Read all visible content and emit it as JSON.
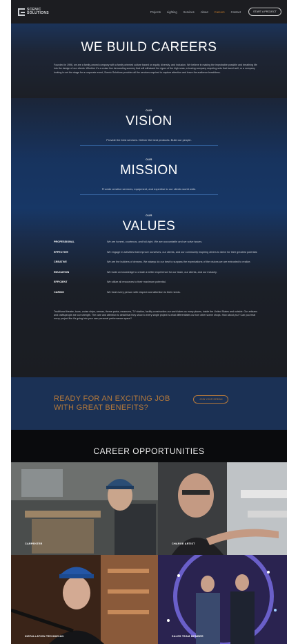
{
  "nav": {
    "logo_line1": "SCENIC",
    "logo_line2": "SOLUTIONS",
    "items": [
      "Projects",
      "Lighting",
      "Services",
      "About",
      "Careers",
      "Contact"
    ],
    "cta": "START A PROJECT"
  },
  "hero": {
    "title": "WE BUILD CAREERS",
    "text": "Founded in 1996, we are a family-owned company with a family oriented culture based on equity, diversity, and inclusion. We believe in making the improbable possible and breathing life into the design of our clients. Whether it's a cruise line demanding scenery that will withstand the rigors of the high seas, a touring company requiring sets that travel well, or a company looking to set the stage for a corporate event, Scenic Solutions provides all the services required to capture attention and leave the audience breathless."
  },
  "vision": {
    "kicker": "OUR",
    "title": "VISION",
    "statement": "Provide the best services. Deliver the best products. Build our people."
  },
  "mission": {
    "kicker": "OUR",
    "title": "MISSION",
    "statement": "Provide creative services, equipment, and expertise to our clients world wide."
  },
  "values": {
    "kicker": "OUR",
    "title": "VALUES",
    "rows": [
      {
        "label": "PROFESSIONAL",
        "desc": "We are honest, courteous, and full-right. We are accountable and we solve issues."
      },
      {
        "label": "EFFECTIVE",
        "desc": "We engage in activities that improve ourselves, our clients, and our community inspiring others to strive for their greatest potential."
      },
      {
        "label": "CREATIVE",
        "desc": "We are the builders of dreams. We always do our best to surpass the expectations of the visions we are entrusted to realize."
      },
      {
        "label": "EDUCATION",
        "desc": "We build on knowledge to create a better experience for our team, our clients, and our industry."
      },
      {
        "label": "EFFICIENT",
        "desc": "We utilize all resources to their maximum potential."
      },
      {
        "label": "CARING",
        "desc": "We treat every person with respect and attention to their needs."
      }
    ],
    "closing": "Traditional theatre, tours, cruise ships, arenas, theme parks, museums, TV studios, facility construction-our work takes us many places, inside the United States and outside. Our artisans and craftspeople are our strength. The care and attention to detail that they show to every single project is what differentiates us from other scene shops. How about you? Can you treat every project like it's going into your own personal performance space?"
  },
  "ready": {
    "heading": "READY FOR AN EXCITING JOB WITH GREAT BENEFITS?",
    "button": "JOIN YOUR DREAM"
  },
  "careers": {
    "title": "CAREER OPPORTUNITIES",
    "tiles": [
      {
        "label": "CARPENTER"
      },
      {
        "label": "CHARGE ARTIST"
      },
      {
        "label": "INSTALLATION TECHNICIAN"
      },
      {
        "label": "SALES TEAM MEMBER"
      }
    ]
  },
  "colors": {
    "accent_orange": "#c47a2c",
    "link_blue": "#3f86d6",
    "navy": "#173766"
  }
}
